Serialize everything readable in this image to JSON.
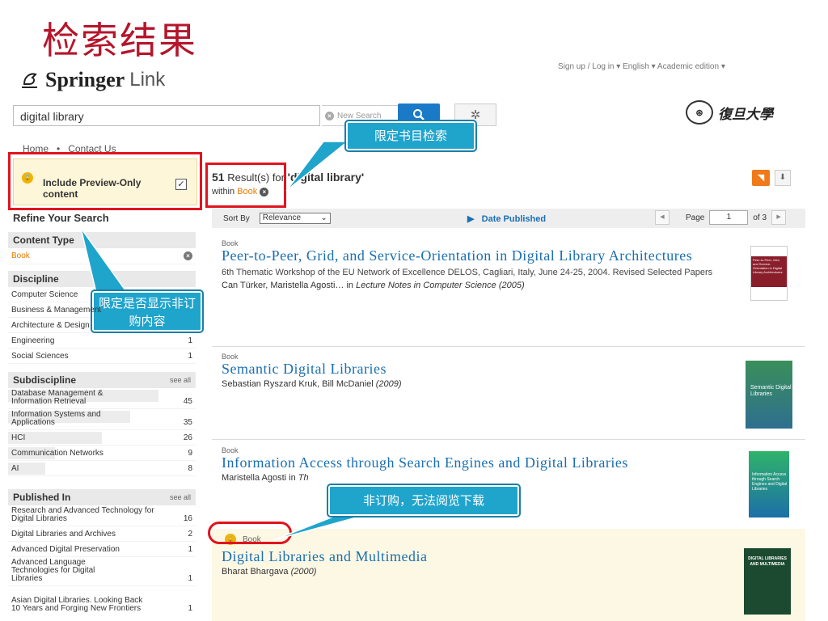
{
  "slide_title": "检索结果",
  "header": {
    "brand": "Springer",
    "brand_suffix": "Link",
    "top_links": "Sign up / Log in  ▾   English  ▾   Academic edition  ▾",
    "university": "復旦大學"
  },
  "search": {
    "query": "digital library",
    "new_search": "New Search"
  },
  "breadcrumb": {
    "home": "Home",
    "sep": "•",
    "contact": "Contact Us"
  },
  "sidebar": {
    "preview_label": "Include Preview-Only content",
    "refine_title": "Refine Your Search",
    "content_type": {
      "title": "Content Type",
      "items": [
        {
          "label": "Book"
        }
      ]
    },
    "discipline": {
      "title": "Discipline",
      "items": [
        {
          "label": "Computer Science",
          "count": ""
        },
        {
          "label": "Business & Management",
          "count": ""
        },
        {
          "label": "Architecture & Design",
          "count": ""
        },
        {
          "label": "Engineering",
          "count": "1"
        },
        {
          "label": "Social Sciences",
          "count": "1"
        }
      ]
    },
    "subdiscipline": {
      "title": "Subdiscipline",
      "see_all": "see all",
      "items": [
        {
          "label": "Database Management & Information Retrieval",
          "count": "45",
          "share": 0.8
        },
        {
          "label": "Information Systems and Applications",
          "count": "35",
          "share": 0.65
        },
        {
          "label": "HCI",
          "count": "26",
          "share": 0.5
        },
        {
          "label": "Communication Networks",
          "count": "9",
          "share": 0.25
        },
        {
          "label": "AI",
          "count": "8",
          "share": 0.2
        }
      ]
    },
    "published_in": {
      "title": "Published In",
      "see_all": "see all",
      "items": [
        {
          "label": "Research and Advanced Technology for Digital Libraries",
          "count": "16"
        },
        {
          "label": "Digital Libraries and Archives",
          "count": "2"
        },
        {
          "label": "Advanced Digital Preservation",
          "count": "1"
        },
        {
          "label": "Advanced Language Technologies for Digital Libraries",
          "count": "1"
        },
        {
          "label": "Asian Digital Libraries. Looking Back 10 Years and Forging New Frontiers",
          "count": "1"
        }
      ]
    }
  },
  "results_header": {
    "count": "51",
    "text": "Result(s) for",
    "query": "'digital library'",
    "within": "within",
    "within_type": "Book"
  },
  "sortbar": {
    "sort_by": "Sort By",
    "sort_value": "Relevance",
    "date_published": "Date Published",
    "page_label": "Page",
    "page_value": "1",
    "of_label": "of 3"
  },
  "results": [
    {
      "type": "Book",
      "title": "Peer-to-Peer, Grid, and Service-Orientation in Digital Library Architectures",
      "desc": "6th Thematic Workshop of the EU Network of Excellence DELOS, Cagliari, Italy, June 24-25, 2004. Revised Selected Papers",
      "authors": "Can Türker, Maristella Agosti…",
      "in_label": "in",
      "series": "Lecture Notes in Computer Science",
      "year": "(2005)",
      "cover_text": "Peer-to-Peer, Grid, and Service-Orientation in Digital Library Architectures"
    },
    {
      "type": "Book",
      "title": "Semantic Digital Libraries",
      "authors": "Sebastian Ryszard Kruk, Bill McDaniel",
      "year": "(2009)",
      "cover_text": "Semantic Digital Libraries"
    },
    {
      "type": "Book",
      "title": "Information Access through Search Engines and Digital Libraries",
      "authors": "Maristella Agosti",
      "in_label": "in",
      "series": "Th",
      "cover_text": "Information Access through Search Engines and Digital Libraries"
    },
    {
      "type": "Book",
      "title": "Digital Libraries and Multimedia",
      "authors": "Bharat Bhargava",
      "year": "(2000)",
      "cover_text": "DIGITAL LIBRARIES AND MULTIMEDIA"
    }
  ],
  "callouts": {
    "book_filter": "限定书目检索",
    "preview_filter": "限定是否显示非订购内容",
    "not_subscribed": "非订购，无法阅览下载"
  },
  "colors": {
    "title_red": "#b5152b",
    "link_blue": "#1a6fb0",
    "callout": "#1fa4cc",
    "highlight_red": "#e0141e"
  }
}
